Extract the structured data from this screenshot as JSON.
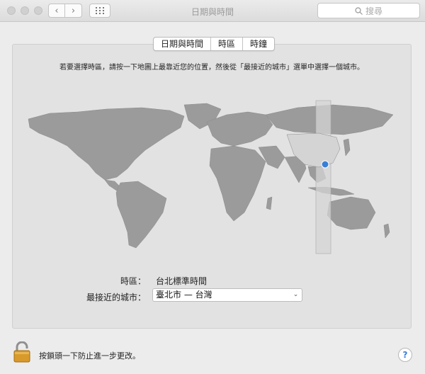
{
  "window": {
    "title": "日期與時間"
  },
  "toolbar": {
    "back_label": "‹",
    "forward_label": "›",
    "search_placeholder": "搜尋"
  },
  "tabs": [
    {
      "label": "日期與時間",
      "active": false
    },
    {
      "label": "時區",
      "active": true
    },
    {
      "label": "時鐘",
      "active": false
    }
  ],
  "instruction": "若要選擇時區，請按一下地圖上最靠近您的位置，然後從「最接近的城市」選單中選擇一個城市。",
  "timezone": {
    "label": "時區：",
    "value": "台北標準時間"
  },
  "closest_city": {
    "label": "最接近的城市：",
    "value": "臺北市 — 台灣"
  },
  "footer": {
    "lock_text": "按鎖頭一下防止進一步更改。",
    "help_label": "?"
  },
  "colors": {
    "accent": "#3a7fd6",
    "land": "#9b9b9b",
    "highlight": "#d4d4d4"
  }
}
